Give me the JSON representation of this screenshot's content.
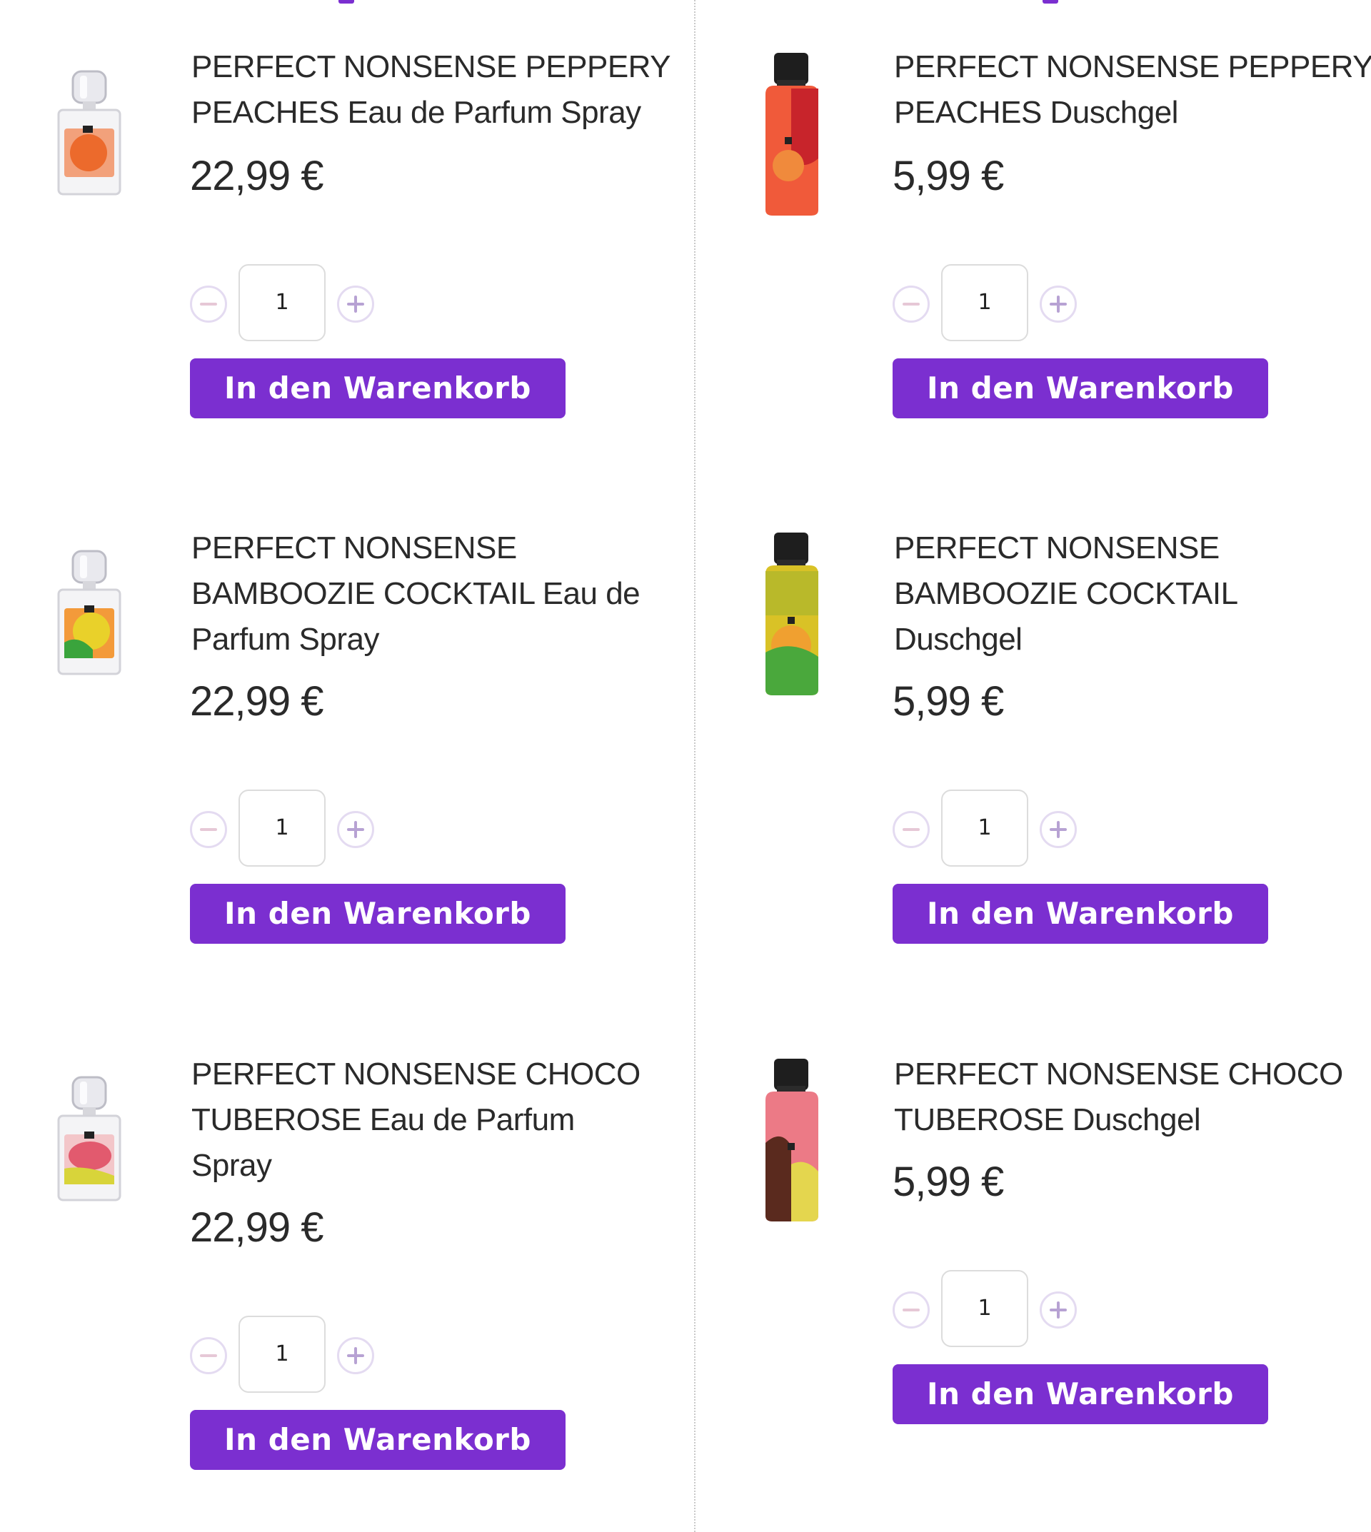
{
  "colors": {
    "accent": "#7b2fd0"
  },
  "products": [
    {
      "title_lines": [
        "PERFECT NONSENSE PEPPERY",
        "PEACHES Eau de Parfum Spray"
      ],
      "price": "22,99 €",
      "quantity": "1",
      "cart_label": "In den Warenkorb",
      "image": "perfume-bottle-peach"
    },
    {
      "title_lines": [
        "PERFECT NONSENSE PEPPERY",
        "PEACHES Duschgel"
      ],
      "price": "5,99 €",
      "quantity": "1",
      "cart_label": "In den Warenkorb",
      "image": "shower-gel-peach"
    },
    {
      "title_lines": [
        "PERFECT NONSENSE",
        "BAMBOOZIE COCKTAIL Eau de",
        "Parfum Spray"
      ],
      "price": "22,99 €",
      "quantity": "1",
      "cart_label": "In den Warenkorb",
      "image": "perfume-bottle-cocktail"
    },
    {
      "title_lines": [
        "PERFECT NONSENSE",
        "BAMBOOZIE COCKTAIL",
        "Duschgel"
      ],
      "price": "5,99 €",
      "quantity": "1",
      "cart_label": "In den Warenkorb",
      "image": "shower-gel-cocktail"
    },
    {
      "title_lines": [
        "PERFECT NONSENSE CHOCO",
        "TUBEROSE Eau de Parfum",
        "Spray"
      ],
      "price": "22,99 €",
      "quantity": "1",
      "cart_label": "In den Warenkorb",
      "image": "perfume-bottle-tuberose"
    },
    {
      "title_lines": [
        "PERFECT NONSENSE CHOCO",
        "TUBEROSE Duschgel"
      ],
      "price": "5,99 €",
      "quantity": "1",
      "cart_label": "In den Warenkorb",
      "image": "shower-gel-tuberose"
    }
  ]
}
